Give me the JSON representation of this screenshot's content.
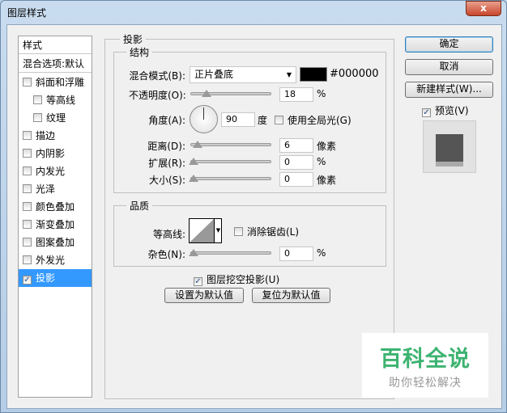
{
  "window": {
    "title": "图层样式",
    "close": "x"
  },
  "styles_panel": {
    "header": "样式",
    "blend": "混合选项:默认",
    "items": [
      {
        "label": "斜面和浮雕",
        "checked": false
      },
      {
        "label": "等高线",
        "checked": false
      },
      {
        "label": "纹理",
        "checked": false
      },
      {
        "label": "描边",
        "checked": false
      },
      {
        "label": "内阴影",
        "checked": false
      },
      {
        "label": "内发光",
        "checked": false
      },
      {
        "label": "光泽",
        "checked": false
      },
      {
        "label": "颜色叠加",
        "checked": false
      },
      {
        "label": "渐变叠加",
        "checked": false
      },
      {
        "label": "图案叠加",
        "checked": false
      },
      {
        "label": "外发光",
        "checked": false
      },
      {
        "label": "投影",
        "checked": true
      }
    ]
  },
  "main": {
    "title": "投影",
    "structure": {
      "title": "结构",
      "blend_label": "混合模式(B):",
      "blend_value": "正片叠底",
      "color": "#000000",
      "color_text": "#000000",
      "opacity_label": "不透明度(O):",
      "opacity": "18",
      "opacity_unit": "%",
      "angle_label": "角度(A):",
      "angle": "90",
      "angle_unit": "度",
      "global_light": "使用全局光(G)",
      "distance_label": "距离(D):",
      "distance": "6",
      "distance_unit": "像素",
      "spread_label": "扩展(R):",
      "spread": "0",
      "spread_unit": "%",
      "size_label": "大小(S):",
      "size": "0",
      "size_unit": "像素"
    },
    "quality": {
      "title": "品质",
      "contour_label": "等高线:",
      "antialias": "消除锯齿(L)",
      "noise_label": "杂色(N):",
      "noise": "0",
      "noise_unit": "%"
    },
    "knockout": "图层挖空投影(U)",
    "set_default": "设置为默认值",
    "reset_default": "复位为默认值"
  },
  "buttons": {
    "ok": "确定",
    "cancel": "取消",
    "new_style": "新建样式(W)...",
    "preview": "预览(V)"
  },
  "watermark": {
    "title": "百科全说",
    "subtitle": "助你轻松解决"
  }
}
